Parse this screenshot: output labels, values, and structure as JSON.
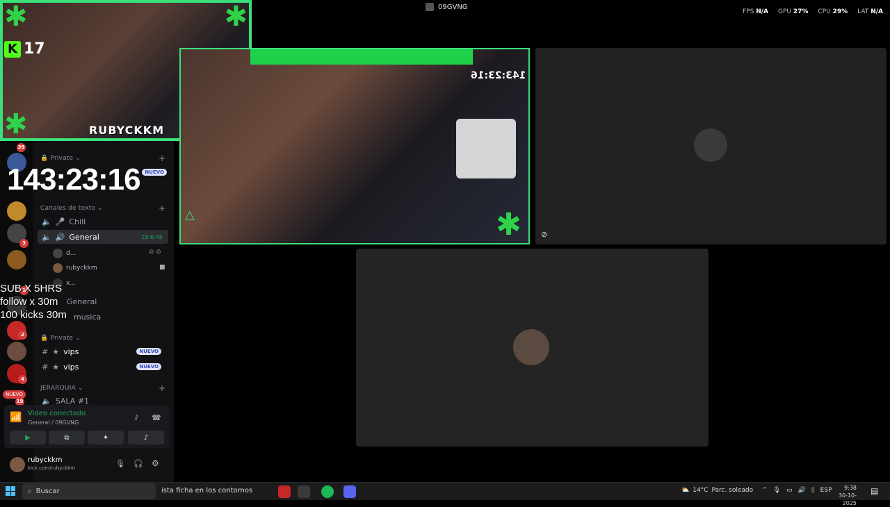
{
  "window": {
    "title": "09GVNG"
  },
  "perf": {
    "fps_label": "FPS",
    "fps": "N/A",
    "gpu_label": "GPU",
    "gpu": "27%",
    "cpu_label": "CPU",
    "cpu": "29%",
    "lat_label": "LAT",
    "lat": "N/A"
  },
  "overlay": {
    "kick_count": "17",
    "cam_name": "RUBYCKKM",
    "timer": "143:23:16",
    "goals": [
      "SUB X 5HRS",
      "follow x 30m",
      "100 kicks 30m"
    ]
  },
  "rail": {
    "badges": [
      "39",
      "3",
      "1",
      "2",
      "4",
      "19"
    ],
    "nuevo": "NUEVO"
  },
  "sidebar": {
    "cat_private_1": "Private",
    "nuevo_1": "NUEVO",
    "cat_text": "Canales de texto",
    "chill": "Chill",
    "general_active": "General",
    "general_time": "19:6:45",
    "voice_user_1": "d...",
    "voice_user_2": "rubyckkm",
    "voice_user_3": "x...",
    "general_2": "General",
    "musica": "musica",
    "cat_private_2": "Private",
    "vips_1": "vips",
    "vips_2": "vips",
    "nuevo_badge": "NUEVO",
    "cat_jerarquia": "JERARQUIA",
    "sala": "SALA #1"
  },
  "voice_panel": {
    "status": "Video conectado",
    "sub": "General / 09GVNG"
  },
  "user": {
    "name": "rubyckkm",
    "status": "kick.com/rubyckkm"
  },
  "stream": {
    "timer": "143:23:16"
  },
  "taskbar": {
    "search_placeholder": "Buscar",
    "news": "ista ficha en los contornos",
    "weather_temp": "14°C",
    "weather_desc": "Parc. soleado",
    "lang": "ESP",
    "time": "9:38",
    "date": "30-10-2025"
  },
  "colors": {
    "accent_green": "#3ae07a",
    "kick_green": "#53fc18",
    "badge_red": "#d83c3e",
    "discord_bg": "#121214"
  }
}
